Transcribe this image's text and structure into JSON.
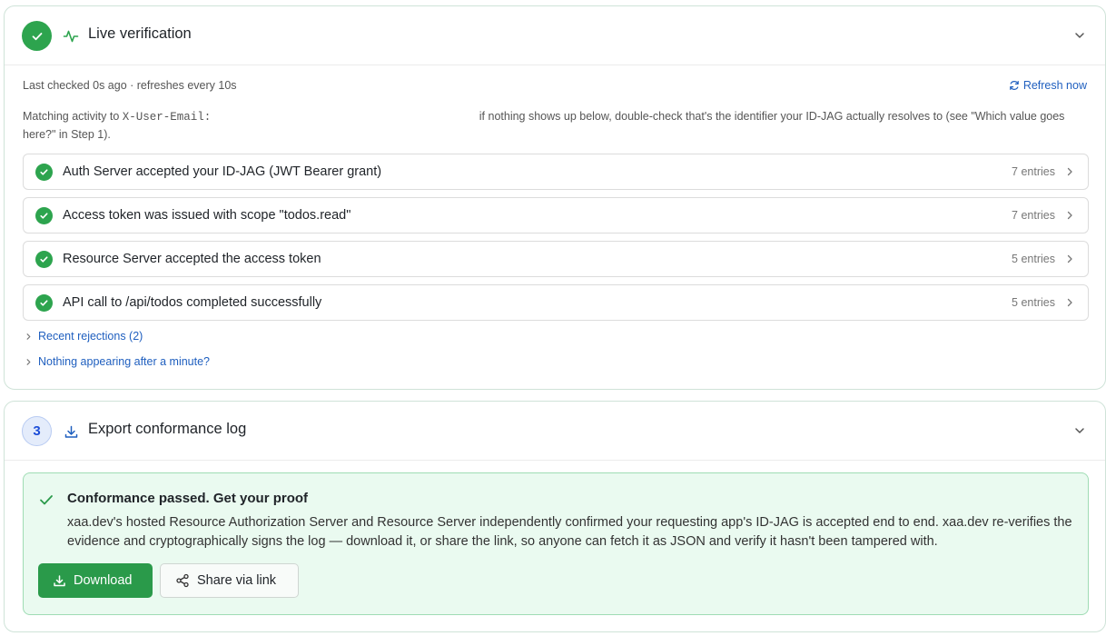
{
  "verification": {
    "title": "Live verification",
    "icon": "activity-icon",
    "status_color": "#2da44e",
    "meta": "Last checked 0s ago · refreshes every 10s",
    "refresh_label": "Refresh now",
    "matching_prefix": "Matching activity to ",
    "matching_header": "X-User-Email:",
    "matching_suffix": " if nothing shows up below, double-check that's the identifier your ID-JAG actually resolves to (see \"Which value goes here?\" in Step 1).",
    "checks": [
      {
        "label": "Auth Server accepted your ID-JAG (JWT Bearer grant)",
        "count": "7 entries"
      },
      {
        "label": "Access token was issued with scope \"todos.read\"",
        "count": "7 entries"
      },
      {
        "label": "Resource Server accepted the access token",
        "count": "5 entries"
      },
      {
        "label": "API call to /api/todos completed successfully",
        "count": "5 entries"
      }
    ],
    "recent_rejections": "Recent rejections (2)",
    "nothing_appearing": "Nothing appearing after a minute?"
  },
  "export": {
    "step_number": "3",
    "title": "Export conformance log",
    "icon": "download-icon",
    "pass_title": "Conformance passed. Get your proof",
    "pass_description": "xaa.dev's hosted Resource Authorization Server and Resource Server independently confirmed your requesting app's ID-JAG is accepted end to end. xaa.dev re-verifies the evidence and cryptographically signs the log — download it, or share the link, so anyone can fetch it as JSON and verify it hasn't been tampered with.",
    "download_label": "Download",
    "share_label": "Share via link",
    "accent_color": "#2a9a4a",
    "link_color": "#1f5fbf"
  }
}
